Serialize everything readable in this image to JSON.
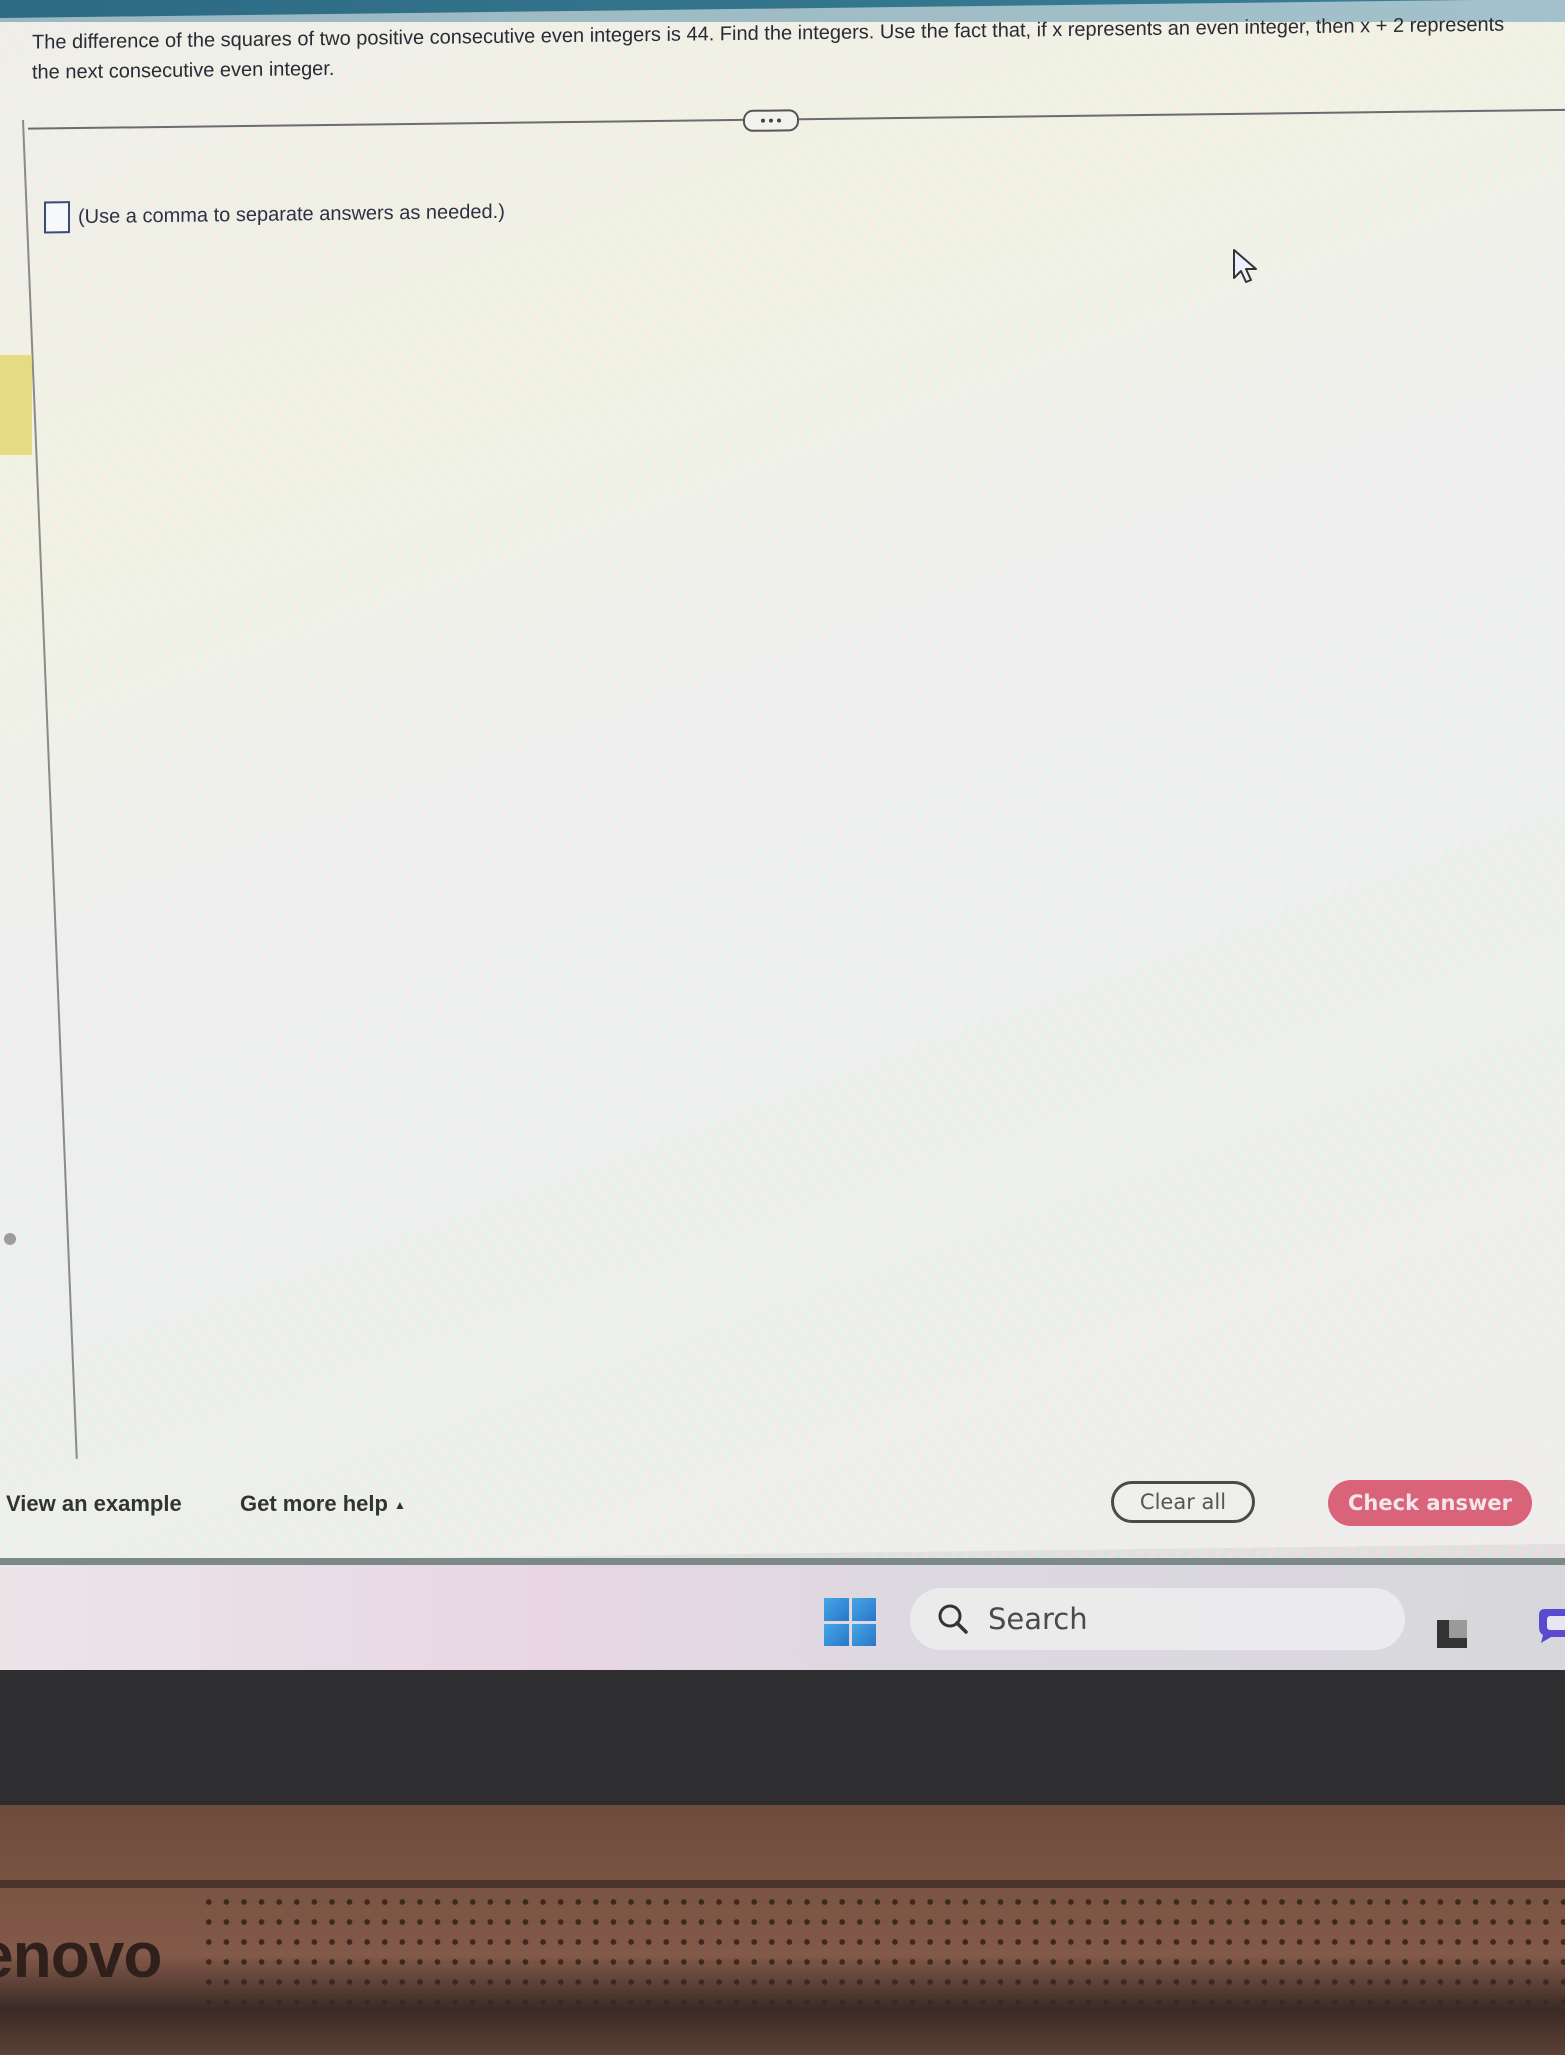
{
  "question": {
    "text": "The difference of the squares of two positive consecutive even integers is 44. Find the integers. Use the fact that, if x represents an even integer, then x + 2 represents the next consecutive even integer.",
    "expand_icon": "ellipsis-icon"
  },
  "answer": {
    "value": "",
    "hint": "(Use a comma to separate answers as needed.)"
  },
  "footer": {
    "view_example": "View an example",
    "get_more_help": "Get more help",
    "get_more_help_icon": "caret-up-icon",
    "clear_all": "Clear all",
    "check_answer": "Check answer"
  },
  "taskbar": {
    "start_icon": "windows-logo-icon",
    "search_placeholder": "Search",
    "search_icon": "search-icon",
    "task_view_icon": "task-view-icon",
    "chat_icon": "chat-icon"
  },
  "device": {
    "brand": "Lenovo",
    "brand_visible": "enovo"
  },
  "colors": {
    "check_answer_bg": "#d9647a",
    "top_bar": "#2c6a82",
    "windows_blue": "#2a76c9"
  }
}
